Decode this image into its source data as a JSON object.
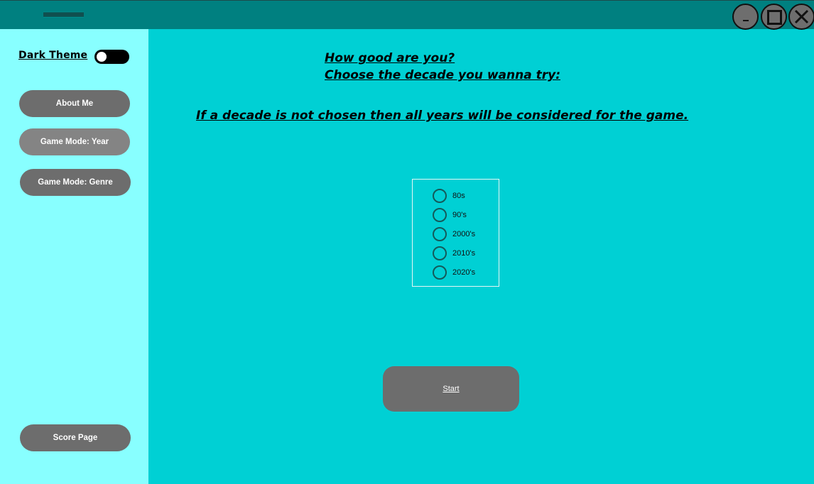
{
  "titlebar": {
    "menu_icon": "hamburger-icon",
    "controls": {
      "minimize_label": "-",
      "maximize_icon": "maximize-icon",
      "close_icon": "close-icon"
    }
  },
  "sidebar": {
    "dark_theme_label": "Dark Theme",
    "dark_theme_enabled": false,
    "buttons": [
      {
        "label": "About Me"
      },
      {
        "label": "Game Mode: Year"
      },
      {
        "label": "Game Mode: Genre"
      },
      {
        "label": "Score Page"
      }
    ]
  },
  "main": {
    "heading_line1": "How good are you? ",
    "heading_line2": "Choose the decade you wanna try: ",
    "notice": "If a decade is not chosen then all years will be considered for the game.",
    "decades": [
      {
        "label": "80s",
        "checked": false
      },
      {
        "label": "90's",
        "checked": false
      },
      {
        "label": "2000's",
        "checked": false
      },
      {
        "label": "2010's",
        "checked": false
      },
      {
        "label": "2020's",
        "checked": false
      }
    ],
    "start_label": "Start"
  },
  "colors": {
    "titlebar": "#008080",
    "sidebar": "#88ffff",
    "main_background": "#00d0d4",
    "button": "#6d6d6d",
    "button_selected": "#848484"
  }
}
